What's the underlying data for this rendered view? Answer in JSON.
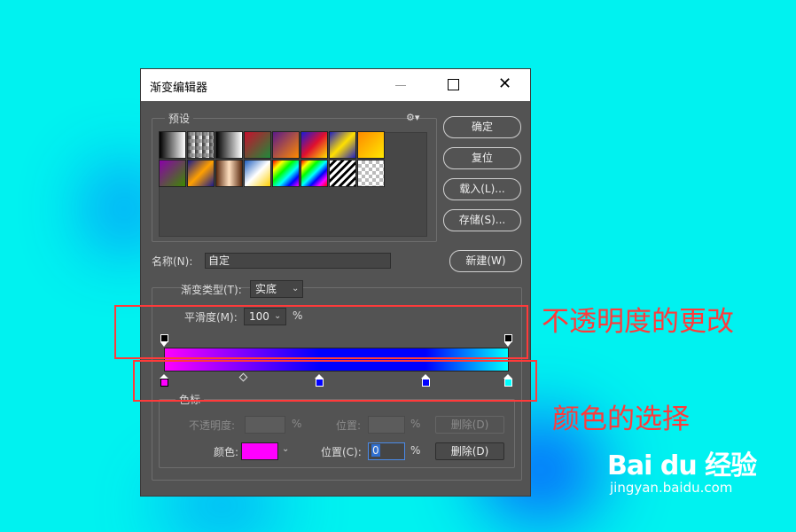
{
  "window": {
    "title": "渐变编辑器",
    "minimize_glyph": "—",
    "maximize_glyph": "☐",
    "close_glyph": "✕"
  },
  "presets": {
    "legend": "预设",
    "menu_icon": "gear-icon",
    "gear_glyph": "⚙▾"
  },
  "buttons": {
    "ok": "确定",
    "reset": "复位",
    "load": "载入(L)...",
    "save": "存储(S)...",
    "new": "新建(W)"
  },
  "name_field": {
    "label": "名称(N):",
    "value": "自定"
  },
  "gradient_type": {
    "label": "渐变类型(T):",
    "value": "实底"
  },
  "smoothness": {
    "label": "平滑度(M):",
    "value": "100",
    "unit": "%"
  },
  "gradient": {
    "opacity_stops": [
      0,
      1
    ],
    "color_stops": [
      {
        "location": 0,
        "color": "#ff00ff"
      },
      {
        "location": 0.45,
        "color": "#0000ff"
      },
      {
        "location": 0.76,
        "color": "#0000ff"
      },
      {
        "location": 1,
        "color": "#00ffff"
      }
    ],
    "midpoint": 0.23
  },
  "stops_panel": {
    "legend": "色标",
    "opacity_label": "不透明度:",
    "opacity_unit": "%",
    "opacity_location_label": "位置:",
    "opacity_location_unit": "%",
    "opacity_delete": "删除(D)",
    "color_label": "颜色:",
    "color_value": "#ff00ff",
    "color_location_label": "位置(C):",
    "color_location_value": "0",
    "color_location_unit": "%",
    "color_delete": "删除(D)"
  },
  "annotations": {
    "opacity_note": "不透明度的更改",
    "color_note": "颜色的选择",
    "highlight_color": "#ff3a3a"
  },
  "watermark": {
    "brand": "Bai du 经验",
    "site": "jingyan.baidu.com"
  }
}
